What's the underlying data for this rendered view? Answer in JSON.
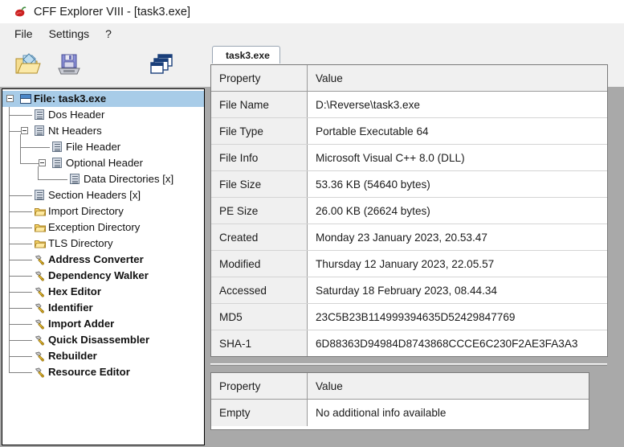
{
  "window": {
    "title": "CFF Explorer VIII - [task3.exe]",
    "icon": "chili-pepper-icon"
  },
  "menubar": {
    "items": [
      {
        "label": "File"
      },
      {
        "label": "Settings"
      },
      {
        "label": "?"
      }
    ]
  },
  "toolbar": {
    "buttons": [
      {
        "name": "open-file-icon",
        "title": "Open"
      },
      {
        "name": "save-file-icon",
        "title": "Save"
      },
      {
        "name": "cascade-windows-icon",
        "title": "Windows"
      }
    ]
  },
  "tree": {
    "nodes": [
      {
        "label": "File: task3.exe",
        "icon": "window-icon",
        "indent": 0,
        "selected": true,
        "bold": true,
        "expander": true
      },
      {
        "label": "Dos Header",
        "icon": "doc-icon",
        "indent": 1,
        "selected": false,
        "bold": false,
        "expander": false
      },
      {
        "label": "Nt Headers",
        "icon": "doc-icon",
        "indent": 1,
        "selected": false,
        "bold": false,
        "expander": true
      },
      {
        "label": "File Header",
        "icon": "doc-icon",
        "indent": 2,
        "selected": false,
        "bold": false,
        "expander": false
      },
      {
        "label": "Optional Header",
        "icon": "doc-icon",
        "indent": 2,
        "selected": false,
        "bold": false,
        "expander": true
      },
      {
        "label": "Data Directories [x]",
        "icon": "doc-icon",
        "indent": 3,
        "selected": false,
        "bold": false,
        "expander": false
      },
      {
        "label": "Section Headers [x]",
        "icon": "doc-icon",
        "indent": 1,
        "selected": false,
        "bold": false,
        "expander": false
      },
      {
        "label": "Import Directory",
        "icon": "folder-icon",
        "indent": 1,
        "selected": false,
        "bold": false,
        "expander": false
      },
      {
        "label": "Exception Directory",
        "icon": "folder-icon",
        "indent": 1,
        "selected": false,
        "bold": false,
        "expander": false
      },
      {
        "label": "TLS Directory",
        "icon": "folder-icon",
        "indent": 1,
        "selected": false,
        "bold": false,
        "expander": false
      },
      {
        "label": "Address Converter",
        "icon": "tool-icon",
        "indent": 1,
        "selected": false,
        "bold": true,
        "expander": false
      },
      {
        "label": "Dependency Walker",
        "icon": "tool-icon",
        "indent": 1,
        "selected": false,
        "bold": true,
        "expander": false
      },
      {
        "label": "Hex Editor",
        "icon": "tool-icon",
        "indent": 1,
        "selected": false,
        "bold": true,
        "expander": false
      },
      {
        "label": "Identifier",
        "icon": "tool-icon",
        "indent": 1,
        "selected": false,
        "bold": true,
        "expander": false
      },
      {
        "label": "Import Adder",
        "icon": "tool-icon",
        "indent": 1,
        "selected": false,
        "bold": true,
        "expander": false
      },
      {
        "label": "Quick Disassembler",
        "icon": "tool-icon",
        "indent": 1,
        "selected": false,
        "bold": true,
        "expander": false
      },
      {
        "label": "Rebuilder",
        "icon": "tool-icon",
        "indent": 1,
        "selected": false,
        "bold": true,
        "expander": false
      },
      {
        "label": "Resource Editor",
        "icon": "tool-icon",
        "indent": 1,
        "selected": false,
        "bold": true,
        "expander": false
      }
    ]
  },
  "tabs": [
    {
      "label": "task3.exe",
      "active": true
    }
  ],
  "main_grid": {
    "columns": [
      "Property",
      "Value"
    ],
    "rows": [
      [
        "File Name",
        "D:\\Reverse\\task3.exe"
      ],
      [
        "File Type",
        "Portable Executable 64"
      ],
      [
        "File Info",
        "Microsoft Visual C++ 8.0 (DLL)"
      ],
      [
        "File Size",
        "53.36 KB (54640 bytes)"
      ],
      [
        "PE Size",
        "26.00 KB (26624 bytes)"
      ],
      [
        "Created",
        "Monday 23 January 2023, 20.53.47"
      ],
      [
        "Modified",
        "Thursday 12 January 2023, 22.05.57"
      ],
      [
        "Accessed",
        "Saturday 18 February 2023, 08.44.34"
      ],
      [
        "MD5",
        "23C5B23B114999394635D52429847769"
      ],
      [
        "SHA-1",
        "6D88363D94984D8743868CCCE6C230F2AE3FA3A3"
      ]
    ]
  },
  "extra_grid": {
    "columns": [
      "Property",
      "Value"
    ],
    "rows": [
      [
        "Empty",
        "No additional info available"
      ]
    ]
  },
  "colors": {
    "selection": "#a8cce8",
    "header_bg": "#f0f0f0",
    "window_bg": "#a9a9a9",
    "accent": "#4a86c8"
  }
}
